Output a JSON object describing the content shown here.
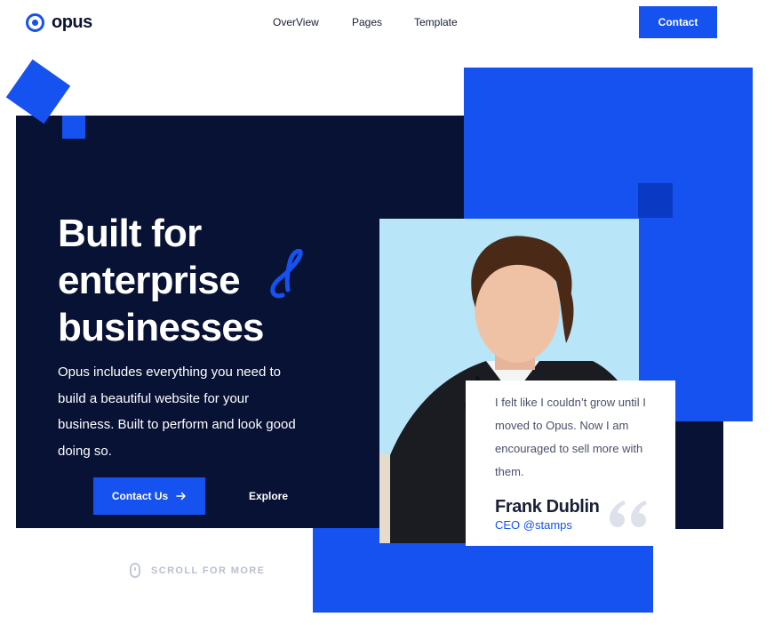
{
  "header": {
    "logo_text": "opus",
    "nav": [
      {
        "label": "OverView"
      },
      {
        "label": "Pages"
      },
      {
        "label": "Template"
      }
    ],
    "contact_label": "Contact"
  },
  "hero": {
    "title_line1": "Built for",
    "title_line2": "enterprise",
    "title_line3": "businesses",
    "description": "Opus includes everything you need to build a beautiful website for your business. Built to perform and look good doing so.",
    "cta_label": "Contact Us",
    "explore_label": "Explore"
  },
  "scroll": {
    "label": "SCROLL FOR MORE"
  },
  "testimonial": {
    "quote": "I felt like I couldn’t grow until I moved to Opus. Now I am encouraged to sell more with them.",
    "name": "Frank Dublin",
    "role_prefix": "CEO ",
    "role_handle": "@stamps"
  },
  "colors": {
    "accent": "#1652f0",
    "navy": "#081235",
    "photo_bg": "#b8e6f8"
  },
  "icons": [
    "logo-icon",
    "arrow-right-icon",
    "mouse-icon",
    "quote-icon",
    "squiggle-decoration"
  ]
}
